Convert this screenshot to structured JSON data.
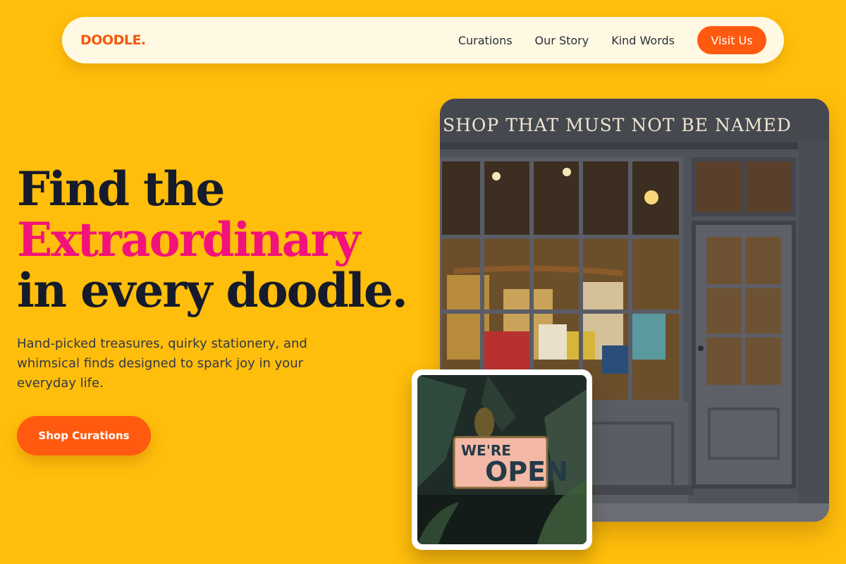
{
  "nav": {
    "logo": "DOODLE.",
    "links": [
      {
        "label": "Curations"
      },
      {
        "label": "Our Story"
      },
      {
        "label": "Kind Words"
      }
    ],
    "cta_label": "Visit Us"
  },
  "hero": {
    "headline_line1": "Find the",
    "headline_accent": "Extraordinary",
    "headline_line3": "in every doodle.",
    "subtext": "Hand-picked treasures, quirky stationery, and whimsical finds designed to spark joy in your everyday life.",
    "cta_label": "Shop Curations"
  },
  "images": {
    "storefront_sign": "SHOP THAT MUST NOT BE NAMED",
    "open_sign_top": "WE'RE",
    "open_sign_bottom": "OPEN"
  },
  "colors": {
    "background": "#FFBE0B",
    "nav_background": "#FFF8E3",
    "brand_orange": "#FF5A0F",
    "accent_pink": "#F2127B",
    "heading_dark": "#161B2B"
  },
  "icons": {
    "storefront": "storefront-photo",
    "open_sign": "open-sign-photo"
  }
}
